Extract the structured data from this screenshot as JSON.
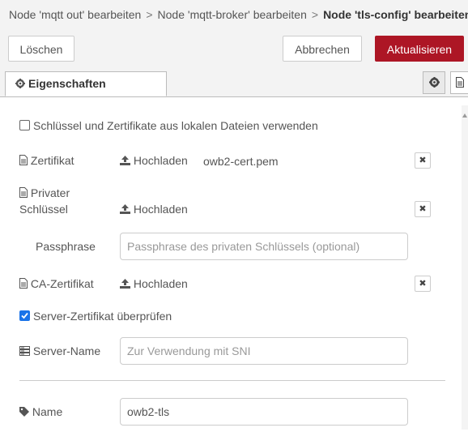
{
  "breadcrumb": {
    "item1": "Node 'mqtt out' bearbeiten",
    "sep": ">",
    "item2": "Node 'mqtt-broker' bearbeiten",
    "current": "Node 'tls-config' bearbeiten"
  },
  "buttons": {
    "delete": "Löschen",
    "cancel": "Abbrechen",
    "update": "Aktualisieren"
  },
  "tabs": {
    "properties": "Eigenschaften"
  },
  "form": {
    "local_files_checkbox": {
      "label": "Schlüssel und Zertifikate aus lokalen Dateien verwenden",
      "checked": false
    },
    "certificate": {
      "label": "Zertifikat",
      "upload": "Hochladen",
      "filename": "owb2-cert.pem"
    },
    "private_key": {
      "label_line1": "Privater",
      "label_line2": "Schlüssel",
      "upload": "Hochladen"
    },
    "passphrase": {
      "label": "Passphrase",
      "placeholder": "Passphrase des privaten Schlüssels (optional)"
    },
    "ca_certificate": {
      "label": "CA-Zertifikat",
      "upload": "Hochladen"
    },
    "verify_server": {
      "label": "Server-Zertifikat überprüfen",
      "checked": true
    },
    "server_name": {
      "label": "Server-Name",
      "placeholder": "Zur Verwendung mit SNI"
    },
    "name": {
      "label": "Name",
      "value": "owb2-tls"
    }
  },
  "colors": {
    "primary": "#ad1625",
    "checkbox": "#1a73e8"
  },
  "icons": [
    "gear-icon",
    "file-icon",
    "upload-icon",
    "times-icon",
    "server-icon",
    "tag-icon"
  ]
}
